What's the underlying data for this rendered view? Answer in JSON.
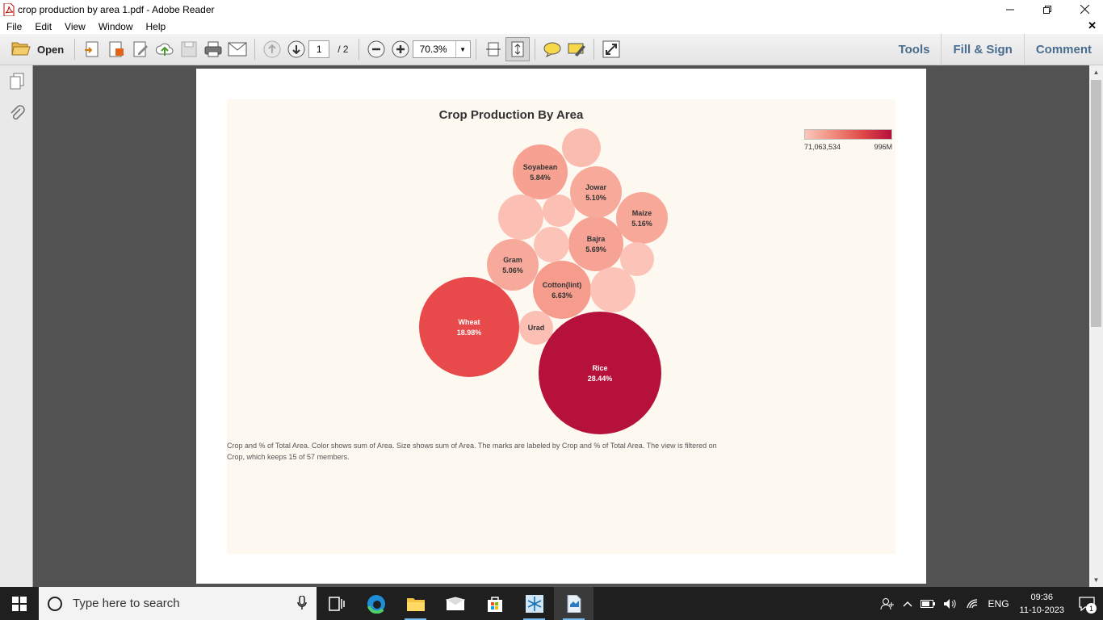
{
  "window": {
    "title": "crop production by area 1.pdf - Adobe Reader"
  },
  "menu": {
    "items": [
      "File",
      "Edit",
      "View",
      "Window",
      "Help"
    ]
  },
  "toolbar": {
    "open_label": "Open",
    "page_current": "1",
    "page_total": "/ 2",
    "zoom": "70.3%",
    "right_tabs": [
      "Tools",
      "Fill & Sign",
      "Comment"
    ]
  },
  "viz": {
    "title": "Crop Production By Area",
    "legend_min": "71,063,534",
    "legend_max": "996M",
    "caption_line1": "Crop and % of Total Area.  Color shows sum of Area.  Size shows sum of Area.  The marks are labeled by Crop and % of Total Area. The view is filtered on",
    "caption_line2": "Crop, which keeps 15 of 57 members."
  },
  "chart_data": {
    "type": "bubble",
    "title": "Crop Production By Area",
    "color_legend": {
      "min": "71,063,534",
      "max": "996M"
    },
    "series": [
      {
        "crop": "Rice",
        "pct": "28.44%",
        "share": 28.44,
        "color": "#b5113a",
        "label_color": "#ffffff"
      },
      {
        "crop": "Wheat",
        "pct": "18.98%",
        "share": 18.98,
        "color": "#e8494a",
        "label_color": "#ffffff"
      },
      {
        "crop": "Cotton(lint)",
        "pct": "6.63%",
        "share": 6.63,
        "color": "#f69c8d",
        "label_color": "#333333"
      },
      {
        "crop": "Soyabean",
        "pct": "5.84%",
        "share": 5.84,
        "color": "#f6a192",
        "label_color": "#333333"
      },
      {
        "crop": "Bajra",
        "pct": "5.69%",
        "share": 5.69,
        "color": "#f6a294",
        "label_color": "#333333"
      },
      {
        "crop": "Maize",
        "pct": "5.16%",
        "share": 5.16,
        "color": "#f7a899",
        "label_color": "#333333"
      },
      {
        "crop": "Jowar",
        "pct": "5.10%",
        "share": 5.1,
        "color": "#f7a99a",
        "label_color": "#333333"
      },
      {
        "crop": "Gram",
        "pct": "5.06%",
        "share": 5.06,
        "color": "#f7aa9b",
        "label_color": "#333333"
      },
      {
        "crop": "Urad",
        "pct": "",
        "color": "#fbbfb3",
        "label_color": "#333333"
      },
      {
        "crop": "",
        "pct": "",
        "color": "#fbbcb0",
        "label_color": "#333333"
      },
      {
        "crop": "",
        "pct": "",
        "color": "#fbbfb3",
        "label_color": "#333333"
      },
      {
        "crop": "",
        "pct": "",
        "color": "#fbbfb3",
        "label_color": "#333333"
      },
      {
        "crop": "",
        "pct": "",
        "color": "#fcc3b8",
        "label_color": "#333333"
      },
      {
        "crop": "",
        "pct": "",
        "color": "#fcc3b8",
        "label_color": "#333333"
      },
      {
        "crop": "",
        "pct": "",
        "color": "#fcc3b8",
        "label_color": "#333333"
      }
    ]
  },
  "taskbar": {
    "search_placeholder": "Type here to search",
    "lang": "ENG",
    "time": "09:36",
    "date": "11-10-2023",
    "notification_count": "1"
  }
}
